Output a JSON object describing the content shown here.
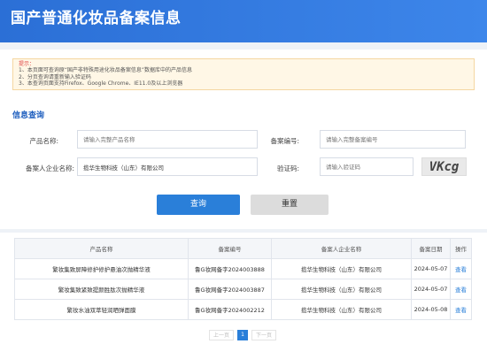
{
  "header": {
    "title": "国产普通化妆品备案信息"
  },
  "notice": {
    "heading": "提示：",
    "lines": [
      "1、本页面可查询原“国产非特殊用途化妆品备案信息”数据库中的产品信息",
      "2、分页查询请重新输入验证码",
      "3、本查询页面支持Firefox、Google Chrome、IE11.0及以上浏览器"
    ]
  },
  "form": {
    "section_title": "信息查询",
    "product_name_label": "产品名称:",
    "product_name_placeholder": "请输入完整产品名称",
    "record_no_label": "备案编号:",
    "record_no_placeholder": "请输入完整备案编号",
    "company_label": "备案人企业名称:",
    "company_value": "揽华生物科技（山东）有限公司",
    "captcha_label": "验证码:",
    "captcha_placeholder": "请输入验证码",
    "captcha_text": "VKcg"
  },
  "buttons": {
    "search": "查询",
    "reset": "重置"
  },
  "table": {
    "headers": [
      "产品名称",
      "备案编号",
      "备案人企业名称",
      "备案日期",
      "操作"
    ],
    "rows": [
      [
        "繁妆集致屏障修护修护悬油次抛精华液",
        "鲁G妆网备字2024003888",
        "揽华生物科技（山东）有限公司",
        "2024-05-07",
        "查看"
      ],
      [
        "繁妆集致紧致提颜胜肽次抛精华液",
        "鲁G妆网备字2024003887",
        "揽华生物科技（山东）有限公司",
        "2024-05-07",
        "查看"
      ],
      [
        "繁妆水油双萃轻润晒弹面膜",
        "鲁G妆网备字2024002212",
        "揽华生物科技（山东）有限公司",
        "2024-05-08",
        "查看"
      ]
    ]
  },
  "pager": {
    "prev": "上一页",
    "current": "1",
    "next": "下一页"
  }
}
